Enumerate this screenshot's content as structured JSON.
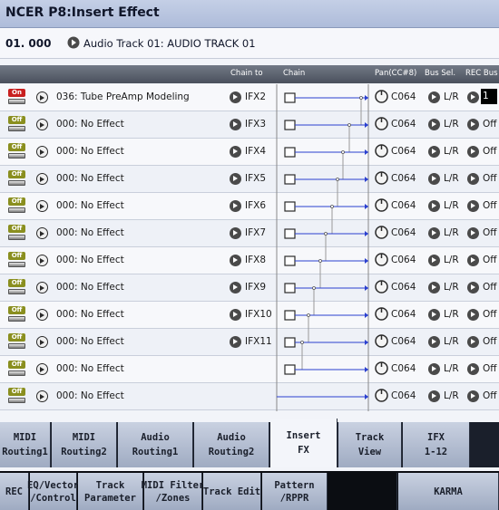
{
  "title_bar": {
    "title": "NCER P8:Insert Effect"
  },
  "track": {
    "number": "01. 000",
    "name": "Audio Track 01: AUDIO TRACK 01"
  },
  "columns": {
    "chain_to": "Chain to",
    "chain": "Chain",
    "pan": "Pan(CC#8)",
    "bus_sel": "Bus Sel.",
    "rec_bus": "REC Bus"
  },
  "rows": [
    {
      "onoff": "On",
      "effect": "036: Tube PreAmp Modeling",
      "chain_to": "IFX2",
      "pan": "C064",
      "bus": "L/R",
      "rec": "1"
    },
    {
      "onoff": "Off",
      "effect": "000: No Effect",
      "chain_to": "IFX3",
      "pan": "C064",
      "bus": "L/R",
      "rec": "Off"
    },
    {
      "onoff": "Off",
      "effect": "000: No Effect",
      "chain_to": "IFX4",
      "pan": "C064",
      "bus": "L/R",
      "rec": "Off"
    },
    {
      "onoff": "Off",
      "effect": "000: No Effect",
      "chain_to": "IFX5",
      "pan": "C064",
      "bus": "L/R",
      "rec": "Off"
    },
    {
      "onoff": "Off",
      "effect": "000: No Effect",
      "chain_to": "IFX6",
      "pan": "C064",
      "bus": "L/R",
      "rec": "Off"
    },
    {
      "onoff": "Off",
      "effect": "000: No Effect",
      "chain_to": "IFX7",
      "pan": "C064",
      "bus": "L/R",
      "rec": "Off"
    },
    {
      "onoff": "Off",
      "effect": "000: No Effect",
      "chain_to": "IFX8",
      "pan": "C064",
      "bus": "L/R",
      "rec": "Off"
    },
    {
      "onoff": "Off",
      "effect": "000: No Effect",
      "chain_to": "IFX9",
      "pan": "C064",
      "bus": "L/R",
      "rec": "Off"
    },
    {
      "onoff": "Off",
      "effect": "000: No Effect",
      "chain_to": "IFX10",
      "pan": "C064",
      "bus": "L/R",
      "rec": "Off"
    },
    {
      "onoff": "Off",
      "effect": "000: No Effect",
      "chain_to": "IFX11",
      "pan": "C064",
      "bus": "L/R",
      "rec": "Off"
    },
    {
      "onoff": "Off",
      "effect": "000: No Effect",
      "chain_to": "",
      "pan": "C064",
      "bus": "L/R",
      "rec": "Off"
    },
    {
      "onoff": "Off",
      "effect": "000: No Effect",
      "chain_to": "",
      "pan": "C064",
      "bus": "L/R",
      "rec": "Off"
    }
  ],
  "tabs_top": [
    {
      "label": "MIDI\nRouting1"
    },
    {
      "label": "MIDI\nRouting2"
    },
    {
      "label": "Audio\nRouting1"
    },
    {
      "label": "Audio\nRouting2"
    },
    {
      "label": "Insert\nFX"
    },
    {
      "label": "Track\nView"
    },
    {
      "label": "IFX\n1-12"
    }
  ],
  "tabs_bottom": [
    {
      "label": "REC"
    },
    {
      "label": "EQ/Vector\n/Control"
    },
    {
      "label": "Track\nParameter"
    },
    {
      "label": "MIDI Filter\n/Zones"
    },
    {
      "label": "Track Edit"
    },
    {
      "label": "Pattern\n/RPPR"
    },
    {
      "label": ""
    },
    {
      "label": "KARMA"
    }
  ],
  "colors": {
    "accent": "#2a3fcf",
    "title_bg": "#b7c4de",
    "active_led": "#c82020",
    "off_led": "#8a8f1f"
  },
  "icons": [
    "select-arrow-icon",
    "chain-arrow-icon",
    "pan-knob-icon",
    "on-off-switch-icon"
  ]
}
